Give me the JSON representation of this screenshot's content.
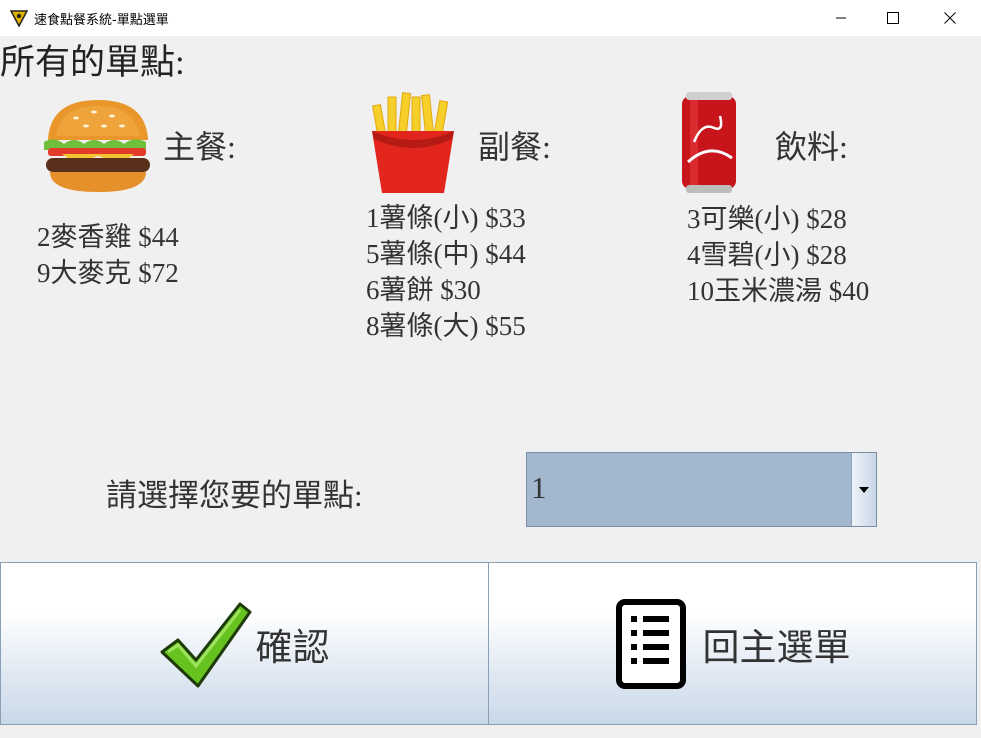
{
  "window": {
    "title": "速食點餐系統-單點選單",
    "minimize_icon": "minimize-icon",
    "maximize_icon": "maximize-icon",
    "close_icon": "close-icon"
  },
  "heading": "所有的單點:",
  "categories": [
    {
      "icon": "burger-icon",
      "label": "主餐:",
      "items": [
        "2麥香雞 $44",
        "9大麥克 $72"
      ]
    },
    {
      "icon": "fries-icon",
      "label": "副餐:",
      "items": [
        "1薯條(小) $33",
        "5薯條(中) $44",
        "6薯餅 $30",
        "8薯條(大) $55"
      ]
    },
    {
      "icon": "cola-can-icon",
      "label": "飲料:",
      "items": [
        "3可樂(小) $28",
        "4雪碧(小) $28",
        "10玉米濃湯 $40"
      ]
    }
  ],
  "selector": {
    "label": "請選擇您要的單點:",
    "value": "1",
    "arrow_icon": "dropdown-arrow-icon"
  },
  "buttons": {
    "confirm": {
      "label": "確認",
      "icon": "checkmark-icon"
    },
    "back": {
      "label": "回主選單",
      "icon": "list-document-icon"
    }
  },
  "colors": {
    "background": "#f0f0f0",
    "combo_fill": "#a3b8cf",
    "button_gradient_end": "#c9d8e8"
  }
}
